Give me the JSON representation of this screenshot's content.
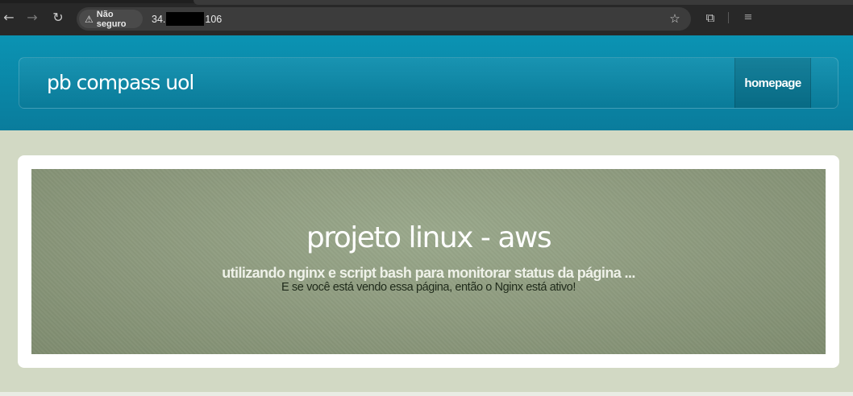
{
  "browser": {
    "back_icon": "←",
    "forward_icon": "→",
    "reload_icon": "↻",
    "security_icon": "⚠",
    "security_label": "Não seguro",
    "url_prefix": "34.",
    "url_suffix": "106",
    "bookmark_icon": "☆",
    "extensions_icon": "⧉",
    "queue_icon": "≡"
  },
  "header": {
    "brand": "pb compass uol",
    "nav_link": "homepage",
    "band_color": "#0b93b3"
  },
  "hero": {
    "title": "projeto linux - aws",
    "subtitle": "utilizando nginx e script bash para monitorar status da página ...",
    "note": "E se você está vendo essa página, então o Nginx está ativo!",
    "background_color": "#8d9a7e"
  }
}
